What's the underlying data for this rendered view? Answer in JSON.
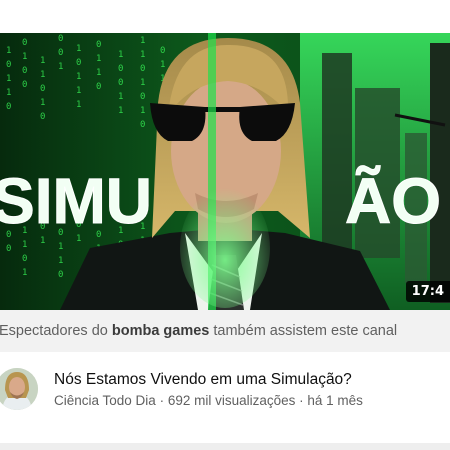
{
  "thumbnail": {
    "overlay_text_left": "SIMU",
    "overlay_text_right": "ÃO",
    "duration": "17:4",
    "accent_color": "#2bd14c"
  },
  "recommendation": {
    "prefix": "Espectadores do ",
    "channel": "bomba games",
    "suffix": " também assistem este canal"
  },
  "video": {
    "title": "Nós Estamos Vivendo em uma Simulação?",
    "channel_name": "Ciência Todo Dia",
    "views": "692 mil visualizações",
    "age": "há 1 mês",
    "separator": " · "
  }
}
